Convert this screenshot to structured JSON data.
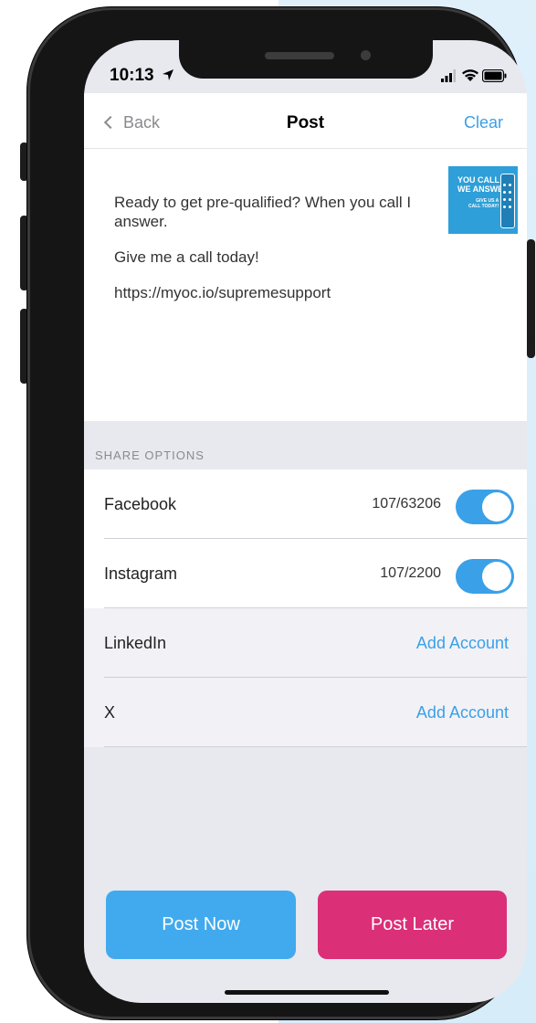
{
  "colors": {
    "accent": "#3aa0e8",
    "post_now": "#41aaee",
    "post_later": "#db2f78",
    "screen_bg": "#e8e8ef",
    "side_panel": "#dff0fb"
  },
  "status_bar": {
    "time": "10:13",
    "icons": [
      "location-arrow-icon",
      "signal-icon",
      "wifi-icon",
      "battery-icon"
    ]
  },
  "nav": {
    "back_label": "Back",
    "title": "Post",
    "clear_label": "Clear"
  },
  "post": {
    "paragraphs": [
      "Ready to get pre-qualified? When you call I answer.",
      "Give me a call today!",
      "https://myoc.io/supremesupport"
    ],
    "thumbnail": {
      "headline": "YOU CALL\nWE ANSWER",
      "sub": "GIVE US A\nCALL TODAY!"
    }
  },
  "share_options": {
    "label": "SHARE OPTIONS",
    "rows": [
      {
        "name": "Facebook",
        "count": "107/63206",
        "enabled": true
      },
      {
        "name": "Instagram",
        "count": "107/2200",
        "enabled": true
      },
      {
        "name": "LinkedIn",
        "action": "Add Account"
      },
      {
        "name": "X",
        "action": "Add Account"
      }
    ]
  },
  "buttons": {
    "post_now": "Post Now",
    "post_later": "Post Later"
  }
}
